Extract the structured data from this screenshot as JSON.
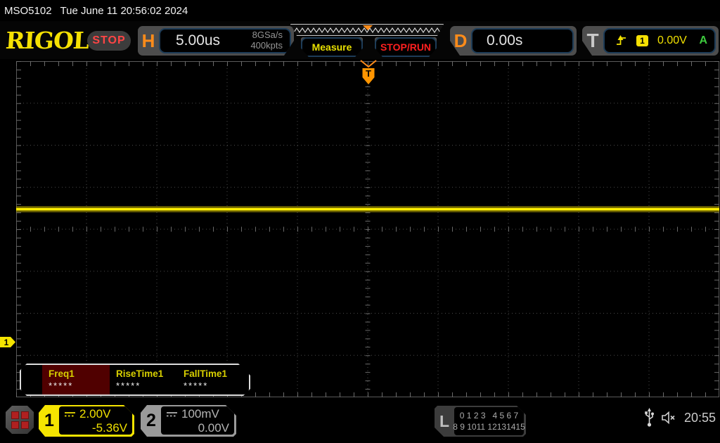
{
  "top_bar": {
    "model": "MSO5102",
    "datetime": "Tue June 11 20:56:02 2024"
  },
  "header": {
    "logo": "RIGOL",
    "run_state": "STOP",
    "horizontal": {
      "label": "H",
      "timebase": "5.00us",
      "sample_rate": "8GSa/s",
      "memory_depth": "400kpts"
    },
    "measure_label": "Measure",
    "stop_run_label": "STOP/RUN",
    "delay": {
      "label": "D",
      "value": "0.00s"
    },
    "trigger": {
      "label": "T",
      "source_channel": "1",
      "level": "0.00V",
      "sweep_mode": "A"
    }
  },
  "graticule": {
    "trigger_marker": "T",
    "ch1_marker": "1",
    "ch1_trace": "flat horizontal line, no activity"
  },
  "measurements": {
    "items": [
      {
        "label": "Freq1",
        "value": "*****",
        "selected": true
      },
      {
        "label": "RiseTime1",
        "value": "*****",
        "selected": false
      },
      {
        "label": "FallTime1",
        "value": "*****",
        "selected": false
      }
    ]
  },
  "channels": [
    {
      "number": "1",
      "scale": "2.00V",
      "offset": "-5.36V",
      "coupling": "DC"
    },
    {
      "number": "2",
      "scale": "100mV",
      "offset": "0.00V",
      "coupling": "DC"
    }
  ],
  "logic": {
    "label": "L",
    "row1": "0 1 2 3   4 5 6 7",
    "row2": "8 9 1011 12131415"
  },
  "status": {
    "time": "20:55",
    "usb_connected": "usb",
    "sound_muted": "muted"
  },
  "colors": {
    "ch1": "#f5e003",
    "ch2": "#9a9a9a",
    "trigger_orange": "#ff8c1a",
    "run_stop_red": "#ff4545",
    "measure_yellow": "#e8e000",
    "trigger_mode_green": "#3ecc3e",
    "selected_measure_bg": "#500000"
  }
}
